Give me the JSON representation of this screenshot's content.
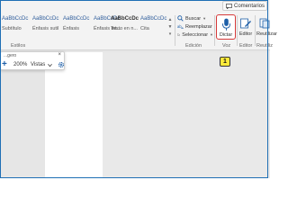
{
  "header": {
    "comments_label": "Comentarios"
  },
  "styles": {
    "items": [
      {
        "sample": "AaBbCcDc",
        "name": "Subtítulo"
      },
      {
        "sample": "AaBbCcDc",
        "name": "Énfasis sutil"
      },
      {
        "sample": "AaBbCcDc",
        "name": "Énfasis"
      },
      {
        "sample": "AaBbCcDc",
        "name": "Énfasis int..."
      },
      {
        "sample": "AaBbCcDc",
        "name": "Texto en n..."
      },
      {
        "sample": "AaBbCcDc",
        "name": "Cita"
      }
    ],
    "group_label": "Estilos"
  },
  "editing": {
    "find_label": "Buscar",
    "replace_label": "Reemplazar",
    "select_label": "Seleccionar",
    "group_label": "Edición"
  },
  "voice": {
    "dictate_label": "Dictar",
    "group_label": "Voz"
  },
  "editor": {
    "label": "Editor",
    "group_label": "Editor"
  },
  "reuse": {
    "label": "Reutilizar",
    "group_label": "Reutiliz"
  },
  "callout": {
    "number": "1"
  },
  "floater": {
    "title": "...gero",
    "zoom": "200%",
    "view_label": "Vistas"
  },
  "colors": {
    "accent": "#1e5fa8",
    "highlight": "#d63a3a",
    "callout": "#ffeb3b"
  }
}
